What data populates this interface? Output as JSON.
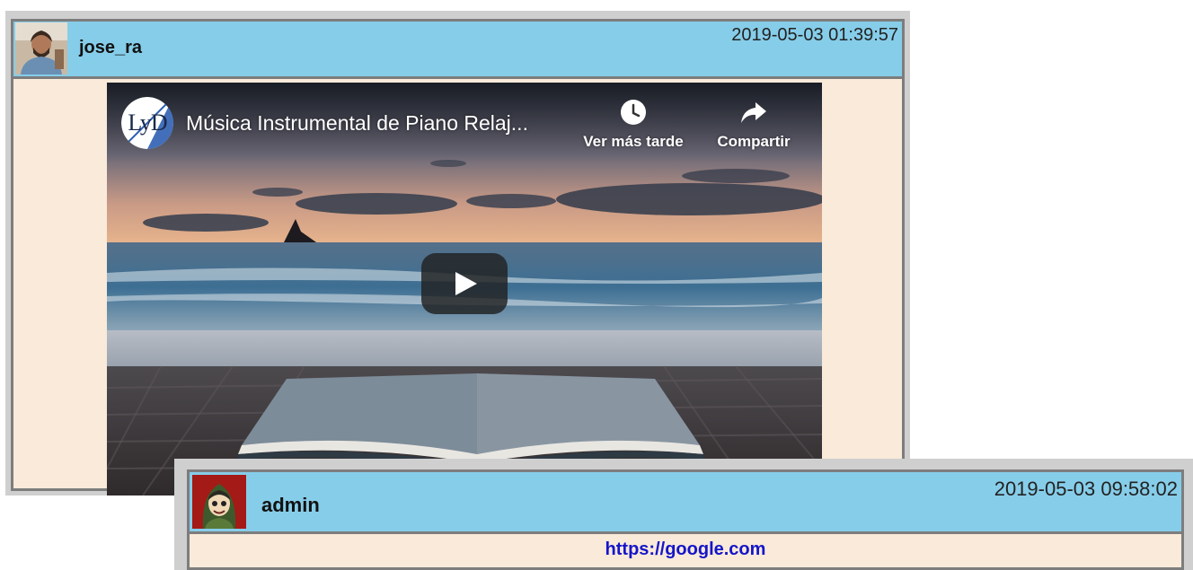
{
  "posts": [
    {
      "username": "jose_ra",
      "timestamp": "2019-05-03 01:39:57",
      "video": {
        "channel_logo_text": "LyD",
        "title": "Música Instrumental de Piano Relaj...",
        "watch_later_label": "Ver más tarde",
        "share_label": "Compartir",
        "icons": [
          "clock-icon",
          "share-arrow-icon",
          "play-icon"
        ]
      }
    },
    {
      "username": "admin",
      "timestamp": "2019-05-03 09:58:02",
      "link_text": "https://google.com"
    }
  ],
  "colors": {
    "header_bg": "#86cde9",
    "body_bg": "#f9ead9",
    "frame_border": "#7d7d7d",
    "outer_frame": "#cfcfcf",
    "link": "#1515c9"
  }
}
